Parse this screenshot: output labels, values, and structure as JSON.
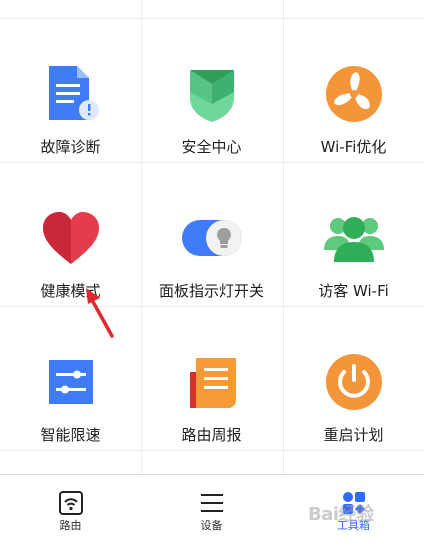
{
  "grid": {
    "tiles": [
      {
        "label": "故障诊断",
        "icon": "document-diagnosis-icon"
      },
      {
        "label": "安全中心",
        "icon": "shield-icon"
      },
      {
        "label": "Wi-Fi优化",
        "icon": "fan-icon"
      },
      {
        "label": "健康模式",
        "icon": "heart-icon"
      },
      {
        "label": "面板指示灯开关",
        "icon": "light-toggle-icon"
      },
      {
        "label": "访客 Wi-Fi",
        "icon": "guests-icon"
      },
      {
        "label": "智能限速",
        "icon": "sliders-icon"
      },
      {
        "label": "路由周报",
        "icon": "report-icon"
      },
      {
        "label": "重启计划",
        "icon": "power-icon"
      }
    ]
  },
  "tabbar": {
    "tabs": [
      {
        "label": "路由",
        "icon": "router-wifi-icon",
        "active": false
      },
      {
        "label": "设备",
        "icon": "menu-lines-icon",
        "active": false
      },
      {
        "label": "工具箱",
        "icon": "toolbox-grid-icon",
        "active": true
      }
    ]
  },
  "watermark": {
    "text": "Bai经验"
  },
  "colors": {
    "accent": "#2f6bff",
    "arrow": "#e0282e"
  }
}
